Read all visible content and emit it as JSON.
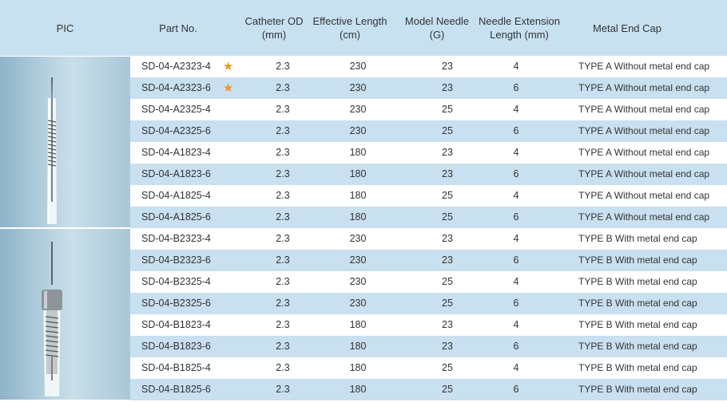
{
  "columns": {
    "pic": "PIC",
    "part": "Part No.",
    "od": [
      "Catheter OD",
      "(mm)"
    ],
    "length": [
      "Effective Length",
      "(cm)"
    ],
    "needle": [
      "Model Needle",
      "(G)"
    ],
    "ext": [
      "Needle Extension",
      "Length (mm)"
    ],
    "cap": "Metal End Cap"
  },
  "star_symbol": "★",
  "colors": {
    "header_bg": "#c7e1f1",
    "alt_row_bg": "#c8e0f0",
    "star": "#f0962a"
  },
  "rows": [
    {
      "part": "SD-04-A2323-4",
      "star": true,
      "od": "2.3",
      "length": "230",
      "needle": "23",
      "ext": "4",
      "cap": "TYPE A Without metal end cap"
    },
    {
      "part": "SD-04-A2323-6",
      "star": true,
      "od": "2.3",
      "length": "230",
      "needle": "23",
      "ext": "6",
      "cap": "TYPE A Without metal end cap"
    },
    {
      "part": "SD-04-A2325-4",
      "star": false,
      "od": "2.3",
      "length": "230",
      "needle": "25",
      "ext": "4",
      "cap": "TYPE A Without metal end cap"
    },
    {
      "part": "SD-04-A2325-6",
      "star": false,
      "od": "2.3",
      "length": "230",
      "needle": "25",
      "ext": "6",
      "cap": "TYPE A Without metal end cap"
    },
    {
      "part": "SD-04-A1823-4",
      "star": false,
      "od": "2.3",
      "length": "180",
      "needle": "23",
      "ext": "4",
      "cap": "TYPE A Without metal end cap"
    },
    {
      "part": "SD-04-A1823-6",
      "star": false,
      "od": "2.3",
      "length": "180",
      "needle": "23",
      "ext": "6",
      "cap": "TYPE A Without metal end cap"
    },
    {
      "part": "SD-04-A1825-4",
      "star": false,
      "od": "2.3",
      "length": "180",
      "needle": "25",
      "ext": "4",
      "cap": "TYPE A Without metal end cap"
    },
    {
      "part": "SD-04-A1825-6",
      "star": false,
      "od": "2.3",
      "length": "180",
      "needle": "25",
      "ext": "6",
      "cap": "TYPE A Without metal end cap"
    },
    {
      "part": "SD-04-B2323-4",
      "star": false,
      "od": "2.3",
      "length": "230",
      "needle": "23",
      "ext": "4",
      "cap": "TYPE B With metal end cap"
    },
    {
      "part": "SD-04-B2323-6",
      "star": false,
      "od": "2.3",
      "length": "230",
      "needle": "23",
      "ext": "6",
      "cap": "TYPE B With metal end cap"
    },
    {
      "part": "SD-04-B2325-4",
      "star": false,
      "od": "2.3",
      "length": "230",
      "needle": "25",
      "ext": "4",
      "cap": "TYPE B With metal end cap"
    },
    {
      "part": "SD-04-B2325-6",
      "star": false,
      "od": "2.3",
      "length": "230",
      "needle": "25",
      "ext": "6",
      "cap": "TYPE B With metal end cap"
    },
    {
      "part": "SD-04-B1823-4",
      "star": false,
      "od": "2.3",
      "length": "180",
      "needle": "23",
      "ext": "4",
      "cap": "TYPE B With metal end cap"
    },
    {
      "part": "SD-04-B1823-6",
      "star": false,
      "od": "2.3",
      "length": "180",
      "needle": "23",
      "ext": "6",
      "cap": "TYPE B With metal end cap"
    },
    {
      "part": "SD-04-B1825-4",
      "star": false,
      "od": "2.3",
      "length": "180",
      "needle": "25",
      "ext": "4",
      "cap": "TYPE B With metal end cap"
    },
    {
      "part": "SD-04-B1825-6",
      "star": false,
      "od": "2.3",
      "length": "180",
      "needle": "25",
      "ext": "6",
      "cap": "TYPE B With metal end cap"
    }
  ]
}
